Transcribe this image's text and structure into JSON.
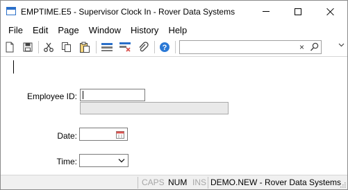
{
  "window": {
    "title": "EMPTIME.E5 - Supervisor Clock In - Rover Data Systems"
  },
  "menu": {
    "items": [
      "File",
      "Edit",
      "Page",
      "Window",
      "History",
      "Help"
    ]
  },
  "toolbar": {
    "icons": [
      "new-page-icon",
      "save-icon",
      "cut-icon",
      "copy-icon",
      "paste-icon",
      "insert-row-icon",
      "delete-row-icon",
      "attachment-icon",
      "help-icon"
    ],
    "search_value": "",
    "search_clear_glyph": "×"
  },
  "form": {
    "employee_id_label": "Employee ID:",
    "employee_id_value": "",
    "employee_name_value": "",
    "date_label": "Date:",
    "date_value": "",
    "time_label": "Time:",
    "time_value": ""
  },
  "status": {
    "caps": "CAPS",
    "num": "NUM",
    "ins": "INS",
    "account": "DEMO.NEW - Rover Data Systems"
  },
  "colors": {
    "accent_blue": "#2a6fc9",
    "help_blue": "#2b79d6",
    "calendar_red": "#d9534f"
  }
}
